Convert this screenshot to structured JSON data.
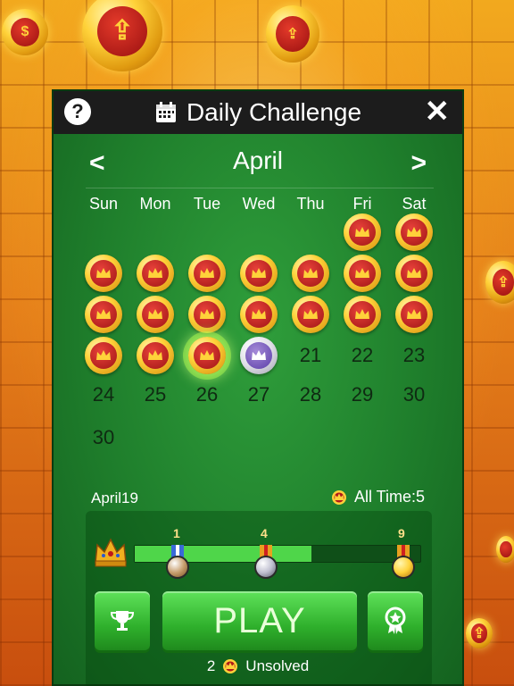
{
  "header": {
    "help_label": "?",
    "title": "Daily Challenge",
    "close_label": "✕"
  },
  "calendar": {
    "month": "April",
    "prev_label": "<",
    "next_label": ">",
    "weekdays": [
      "Sun",
      "Mon",
      "Tue",
      "Wed",
      "Thu",
      "Fri",
      "Sat"
    ],
    "days": {
      "d21": "21",
      "d22": "22",
      "d23": "23",
      "d24": "24",
      "d25": "25",
      "d26": "26",
      "d27": "27",
      "d28": "28",
      "d29": "29",
      "d30": "30",
      "d30b": "30"
    }
  },
  "stats": {
    "period": "April19",
    "all_time": "All Time:5"
  },
  "progress": {
    "milestones": [
      "1",
      "4",
      "9"
    ],
    "fill_fraction": 0.62
  },
  "actions": {
    "play_label": "PLAY",
    "unsolved_count": "2",
    "unsolved_label": "Unsolved"
  },
  "colors": {
    "panel_green": "#1f7f2c",
    "play_green": "#2fb02c",
    "medal_red": "#a01515",
    "medal_gold": "#ffd23a"
  }
}
